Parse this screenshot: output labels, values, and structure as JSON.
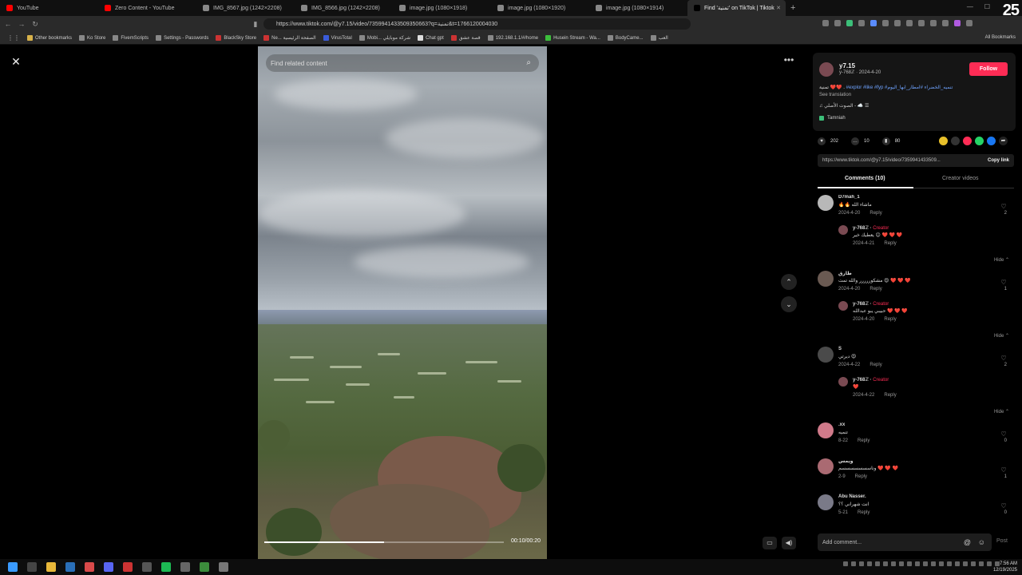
{
  "browser": {
    "tabs": [
      {
        "title": "YouTube",
        "color": "#ff0000",
        "active": false
      },
      {
        "title": "Zero Content - YouTube",
        "color": "#ff0000",
        "active": false
      },
      {
        "title": "IMG_8567.jpg (1242×2208)",
        "color": "#888888",
        "active": false
      },
      {
        "title": "IMG_8566.jpg (1242×2208)",
        "color": "#888888",
        "active": false
      },
      {
        "title": "image.jpg (1080×1918)",
        "color": "#888888",
        "active": false
      },
      {
        "title": "image.jpg (1080×1920)",
        "color": "#888888",
        "active": false
      },
      {
        "title": "image.jpg (1080×1914)",
        "color": "#888888",
        "active": false
      },
      {
        "title": "Find 'تمنية' on TikTok | Tiktok",
        "color": "#000000",
        "active": true
      }
    ],
    "new_tab": "+",
    "badge": "25",
    "url": "https://www.tiktok.com/@y7.15/video/7359941433509350663?q=تمنية&t=1766120004030",
    "bookmarks": [
      {
        "label": "Other bookmarks",
        "color": "#d8b24a"
      },
      {
        "label": "Ko Store",
        "color": "#888888"
      },
      {
        "label": "FivemScripts",
        "color": "#888888"
      },
      {
        "label": "Settings - Passwords",
        "color": "#888888"
      },
      {
        "label": "BlackSky Store",
        "color": "#cc3333"
      },
      {
        "label": "Ne... الصفحة الرئيسية",
        "color": "#cc3333"
      },
      {
        "label": "VirusTotal",
        "color": "#3a5bd9"
      },
      {
        "label": "Mobi... شركة موبايلي",
        "color": "#888888"
      },
      {
        "label": "Chat gpt",
        "color": "#dddddd"
      },
      {
        "label": "قصة عشق",
        "color": "#cc3333"
      },
      {
        "label": "192.168.1.1/#/home",
        "color": "#888888"
      },
      {
        "label": "Husein Stream - Wa...",
        "color": "#3cbf3c"
      },
      {
        "label": "BodyCame...",
        "color": "#888888"
      },
      {
        "label": "العب",
        "color": "#888888"
      }
    ],
    "all_bookmarks": "All Bookmarks"
  },
  "video": {
    "search_placeholder": "Find related content",
    "time": "00:10/00:20",
    "progress": 0.5
  },
  "post": {
    "username": "y7.15",
    "handle_date": "y-768ℤ · 2024-4-20",
    "follow_label": "Follow",
    "caption_prefix": "تمنية ❤️❤️ .",
    "caption_tags": "#explor #like #fyp",
    "caption_suffix": "#تنميه_الخضراء #امطار_ابها_اليوم",
    "see_translation": "See translation",
    "sound": "♫ الصوت الأصلي - ☁️ ☰",
    "playlist": "Tamniah",
    "likes": "202",
    "comments_count": "10",
    "saves": "80",
    "link": "https://www.tiktok.com/@y7.15/video/7359941433509...",
    "copy_link": "Copy link",
    "tab_comments": "Comments (10)",
    "tab_creator": "Creator videos"
  },
  "comments": [
    {
      "name": "D7mah_1",
      "text": "🔥🔥 ماشاء الله",
      "date": "2024-4-20",
      "likes": "2",
      "reply": {
        "name": "y-768ℤ",
        "creator": "Creator",
        "text": "يعطيك خير 😊 ❤️ ❤️ ❤️",
        "date": "2024-4-21",
        "likes": "1"
      },
      "hide": "Hide ⌃"
    },
    {
      "name": "طارق",
      "text": "مشكوررررر والله تمت 😍 ❤️ ❤️ ❤️",
      "date": "2024-4-20",
      "likes": "1",
      "reply": {
        "name": "y-768ℤ",
        "creator": "Creator",
        "text": "حبيبي يبو عبدالله ❤️ ❤️ ❤️",
        "date": "2024-4-20",
        "likes": "2"
      },
      "hide": "Hide ⌃"
    },
    {
      "name": "S",
      "text": "ديرتي 😍",
      "date": "2024-4-22",
      "likes": "2",
      "reply": {
        "name": "y-768ℤ",
        "creator": "Creator",
        "text": "❤️",
        "date": "2024-4-22",
        "likes": "1"
      },
      "hide": "Hide ⌃"
    },
    {
      "name": ".xx",
      "text": "تنميه",
      "date": "8-22",
      "likes": "0"
    },
    {
      "name": "ويمس",
      "text": "وناسسسسسسسم ❤️ ❤️ ❤️",
      "date": "2-9",
      "likes": "1"
    },
    {
      "name": "Abu Nasser.",
      "text": "انت شهراني ؟؟",
      "date": "5-21",
      "likes": "0"
    }
  ],
  "reply_label": "Reply",
  "add_comment": "Add comment...",
  "post_label": "Post",
  "clock": {
    "time": "7:56 AM",
    "date": "12/19/2025"
  }
}
